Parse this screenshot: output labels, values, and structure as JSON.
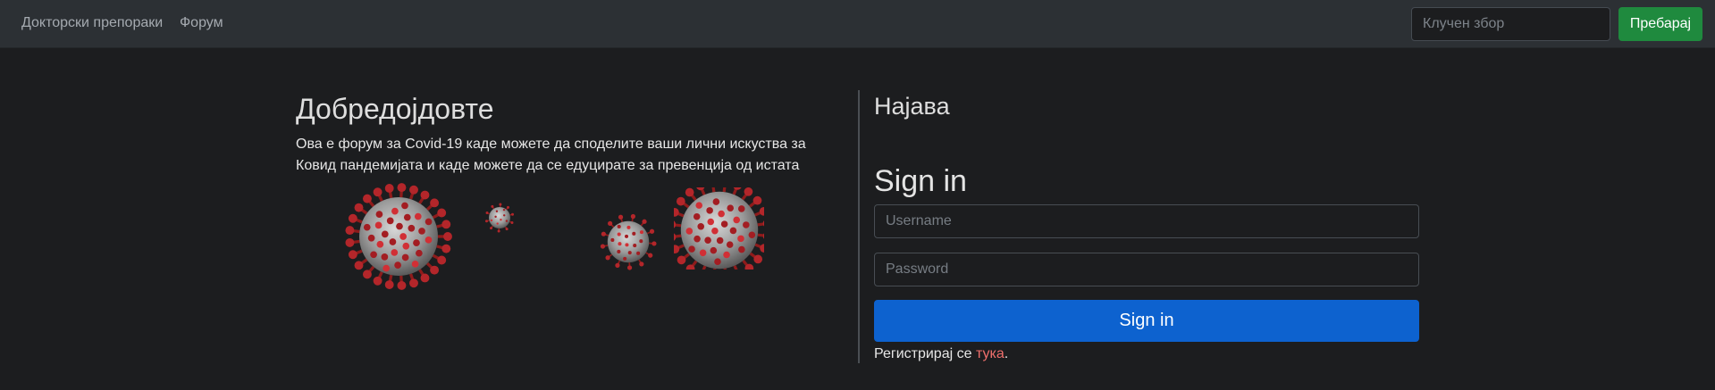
{
  "navbar": {
    "links": [
      "Докторски препораки",
      "Форум"
    ],
    "search": {
      "placeholder": "Клучен збор",
      "value": ""
    },
    "search_button": "Пребарај"
  },
  "welcome": {
    "title": "Добредојдовте",
    "text": "Ова е форум за Covid-19 каде можете да споделите ваши лични искуства за Ковид пандемијата и каде можете да се едуцирате за превенција од истата"
  },
  "login": {
    "heading": "Најава",
    "title": "Sign in",
    "username_placeholder": "Username",
    "password_placeholder": "Password",
    "submit_label": "Sign in",
    "register_prefix": "Регистрирај се ",
    "register_link": "тука",
    "register_suffix": "."
  },
  "colors": {
    "background": "#1c1d1f",
    "navbar": "#2c3034",
    "search_button": "#1f8a3e",
    "primary_button": "#0d62cf",
    "link": "#ef6f6c"
  }
}
